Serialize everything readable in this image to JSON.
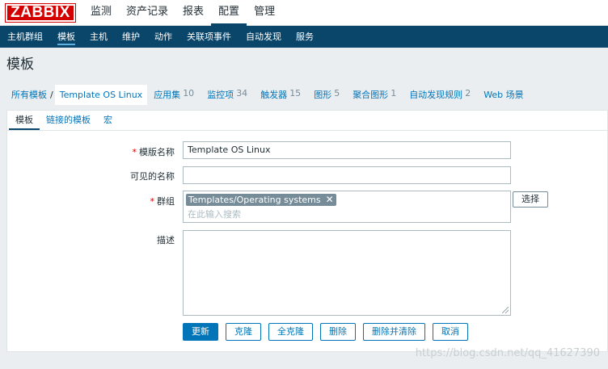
{
  "brand": {
    "logo_text": "ZABBIX",
    "color": "#d40000"
  },
  "top_menu": [
    "监测",
    "资产记录",
    "报表",
    "配置",
    "管理"
  ],
  "sub_menu": [
    "主机群组",
    "模板",
    "主机",
    "维护",
    "动作",
    "关联项事件",
    "自动发现",
    "服务"
  ],
  "page_title": "模板",
  "breadcrumb": {
    "all": "所有模板",
    "sep": "/",
    "current": "Template OS Linux",
    "items": [
      {
        "label": "应用集",
        "count": "10"
      },
      {
        "label": "监控项",
        "count": "34"
      },
      {
        "label": "触发器",
        "count": "15"
      },
      {
        "label": "图形",
        "count": "5"
      },
      {
        "label": "聚合图形",
        "count": "1"
      },
      {
        "label": "自动发现规则",
        "count": "2"
      },
      {
        "label": "Web 场景",
        "count": ""
      }
    ]
  },
  "tabs": [
    "模板",
    "链接的模板",
    "宏"
  ],
  "form": {
    "required_mark": "*",
    "template_name": {
      "label": "模版名称",
      "value": "Template OS Linux"
    },
    "visible_name": {
      "label": "可见的名称",
      "value": ""
    },
    "groups": {
      "label": "群组",
      "chip": "Templates/Operating systems",
      "chip_remove": "✕",
      "placeholder": "在此输入搜索",
      "select_label": "选择"
    },
    "description": {
      "label": "描述",
      "value": ""
    }
  },
  "buttons": [
    "更新",
    "克隆",
    "全克隆",
    "删除",
    "删除并清除",
    "取消"
  ],
  "watermark": "https://blog.csdn.net/qq_41627390"
}
